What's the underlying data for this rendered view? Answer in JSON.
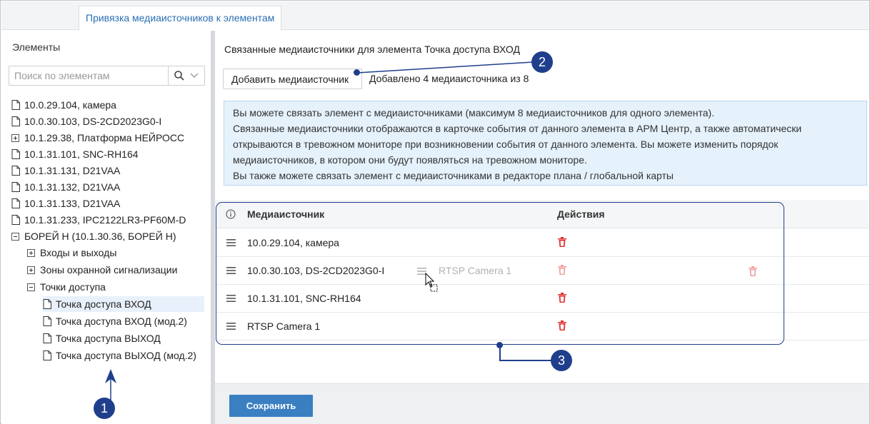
{
  "tab": {
    "label": "Привязка медиаисточников к элементам"
  },
  "left": {
    "title": "Элементы",
    "search": {
      "placeholder": "Поиск по элементам",
      "value": ""
    },
    "tree": [
      {
        "label": "10.0.29.104, камера",
        "kind": "file"
      },
      {
        "label": "10.0.30.103, DS-2CD2023G0-I",
        "kind": "file"
      },
      {
        "label": "10.1.29.38, Платформа НЕЙРОСС",
        "kind": "plus"
      },
      {
        "label": "10.1.31.101, SNC-RH164",
        "kind": "file"
      },
      {
        "label": "10.1.31.131, D21VAA",
        "kind": "file"
      },
      {
        "label": "10.1.31.132, D21VAA",
        "kind": "file"
      },
      {
        "label": "10.1.31.133, D21VAA",
        "kind": "file"
      },
      {
        "label": "10.1.31.233, IPC2122LR3-PF60M-D",
        "kind": "file"
      },
      {
        "label": "БОРЕЙ Н (10.1.30.36, БОРЕЙ Н)",
        "kind": "minus"
      },
      {
        "label": "Входы и выходы",
        "kind": "plus"
      },
      {
        "label": "Зоны охранной сигнализации",
        "kind": "plus"
      },
      {
        "label": "Точки доступа",
        "kind": "minus"
      },
      {
        "label": "Точка доступа ВХОД",
        "kind": "file",
        "selected": true
      },
      {
        "label": "Точка доступа ВХОД (мод.2)",
        "kind": "file"
      },
      {
        "label": "Точка доступа ВЫХОД",
        "kind": "file"
      },
      {
        "label": "Точка доступа ВЫХОД (мод.2)",
        "kind": "file"
      }
    ]
  },
  "right": {
    "title": "Связанные медиаисточники для элемента Точка доступа ВХОД",
    "add_button": "Добавить медиаисточник",
    "added_count": "Добавлено 4 медиаисточника из 8",
    "info_lines": [
      "Вы можете связать элемент с медиаисточниками (максимум 8 медиаисточников для одного элемента).",
      "Связанные медиаисточники отображаются в карточке события от данного элемента в АРМ Центр, а также автоматически",
      "открываются в тревожном мониторе при возникновении события от данного элемента. Вы можете изменить порядок",
      "медиаисточников, в котором они будут появляться на тревожном мониторе.",
      "Вы также можете связать элемент с медиаисточниками в редакторе плана / глобальной карты"
    ],
    "table": {
      "col_source": "Медиаисточник",
      "col_actions": "Действия",
      "rows": [
        "10.0.29.104, камера",
        "10.0.30.103, DS-2CD2023G0-I",
        "10.1.31.101, SNC-RH164",
        "RTSP Camera 1"
      ],
      "dragging_row": "RTSP Camera 1"
    },
    "save_button": "Сохранить"
  },
  "annotations": {
    "badge1": "1",
    "badge2": "2",
    "badge3": "3"
  },
  "colors": {
    "accent": "#3a7fc1",
    "tab_text": "#2a6fb5",
    "delete": "#e03030",
    "callout": "#1f3f8c",
    "info_bg": "#e5f1fb"
  }
}
